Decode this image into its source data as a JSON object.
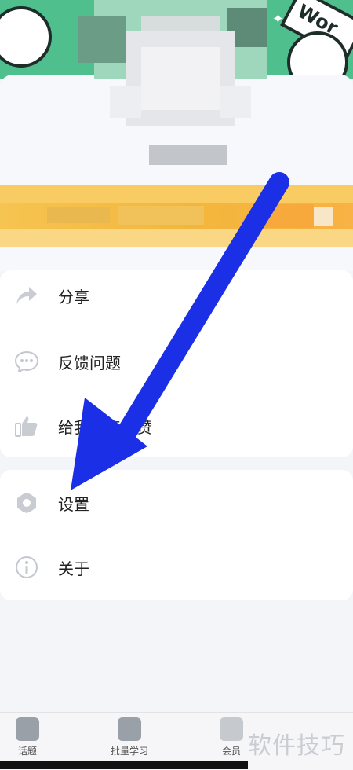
{
  "menu_group_1": [
    {
      "label": "分享",
      "icon": "share-icon"
    },
    {
      "label": "反馈问题",
      "icon": "chat-icon"
    },
    {
      "label": "给我们点个赞",
      "icon": "thumbs-up-icon"
    }
  ],
  "menu_group_2": [
    {
      "label": "设置",
      "icon": "gear-icon"
    },
    {
      "label": "关于",
      "icon": "info-icon"
    }
  ],
  "tabbar": [
    {
      "label": "话题"
    },
    {
      "label": "批量学习"
    },
    {
      "label": "会员"
    }
  ],
  "watermark": "软件技巧",
  "banner": {
    "tag_text": "Wor"
  },
  "colors": {
    "arrow": "#1a2fe6",
    "banner": "#4fbf8e",
    "vip": "#f3b63c"
  }
}
